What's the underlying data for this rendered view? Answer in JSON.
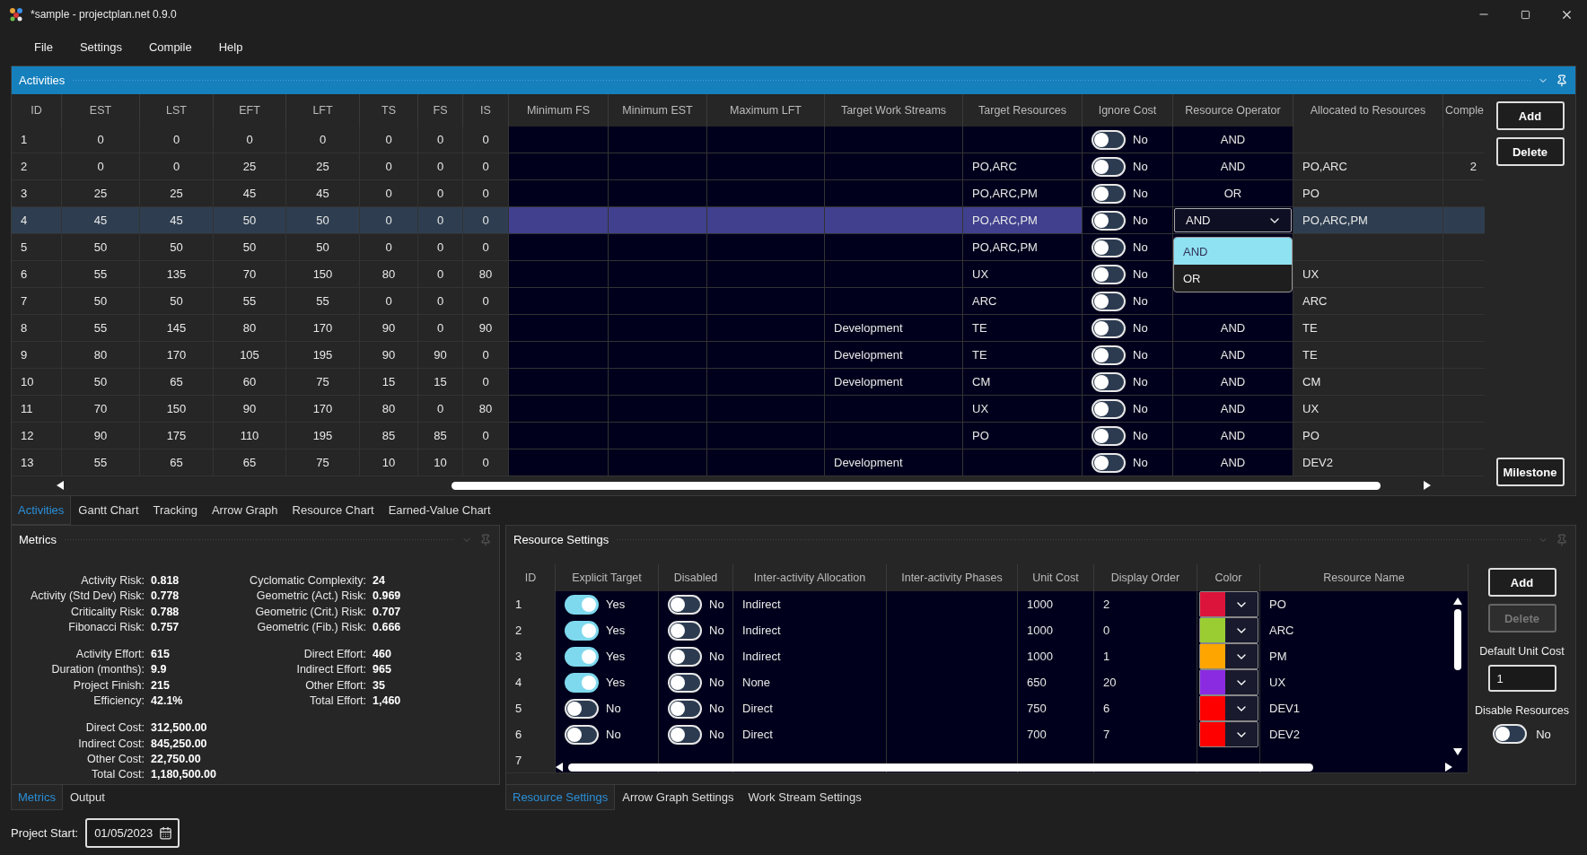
{
  "window": {
    "title": "*sample - projectplan.net 0.9.0"
  },
  "menu": [
    "File",
    "Settings",
    "Compile",
    "Help"
  ],
  "activities": {
    "title": "Activities",
    "columns": [
      "ID",
      "EST",
      "LST",
      "EFT",
      "LFT",
      "TS",
      "FS",
      "IS",
      "Minimum FS",
      "Minimum EST",
      "Maximum LFT",
      "Target Work Streams",
      "Target Resources",
      "Ignore Cost",
      "Resource Operator",
      "Allocated to Resources",
      "Comple"
    ],
    "rows": [
      {
        "cells": [
          "1",
          "0",
          "0",
          "0",
          "0",
          "0",
          "0",
          "0"
        ],
        "ignore_cost": {
          "on": false,
          "label": "No"
        },
        "resource_operator": "AND",
        "selected": false,
        "editing": false
      },
      {
        "cells": [
          "2",
          "0",
          "0",
          "25",
          "25",
          "0",
          "0",
          "0"
        ],
        "target_resources": "PO,ARC",
        "ignore_cost": {
          "on": false,
          "label": "No"
        },
        "resource_operator": "AND",
        "allocated": "PO,ARC",
        "complete": "2",
        "selected": false,
        "editing": false
      },
      {
        "cells": [
          "3",
          "25",
          "25",
          "45",
          "45",
          "0",
          "0",
          "0"
        ],
        "target_resources": "PO,ARC,PM",
        "ignore_cost": {
          "on": false,
          "label": "No"
        },
        "resource_operator": "OR",
        "allocated": "PO",
        "selected": false,
        "editing": false
      },
      {
        "cells": [
          "4",
          "45",
          "45",
          "50",
          "50",
          "0",
          "0",
          "0"
        ],
        "target_resources": "PO,ARC,PM",
        "ignore_cost": {
          "on": false,
          "label": "No"
        },
        "resource_operator": "AND",
        "allocated": "PO,ARC,PM",
        "selected": true,
        "editing": true
      },
      {
        "cells": [
          "5",
          "50",
          "50",
          "50",
          "50",
          "0",
          "0",
          "0"
        ],
        "target_resources": "PO,ARC,PM",
        "ignore_cost": {
          "on": false,
          "label": "No"
        },
        "selected": false,
        "editing": false
      },
      {
        "cells": [
          "6",
          "55",
          "135",
          "70",
          "150",
          "80",
          "0",
          "80"
        ],
        "target_resources": "UX",
        "ignore_cost": {
          "on": false,
          "label": "No"
        },
        "allocated": "UX",
        "selected": false,
        "editing": false
      },
      {
        "cells": [
          "7",
          "50",
          "50",
          "55",
          "55",
          "0",
          "0",
          "0"
        ],
        "target_resources": "ARC",
        "ignore_cost": {
          "on": false,
          "label": "No"
        },
        "allocated": "ARC",
        "selected": false,
        "editing": false
      },
      {
        "cells": [
          "8",
          "55",
          "145",
          "80",
          "170",
          "90",
          "0",
          "90"
        ],
        "target_work_streams": "Development",
        "target_resources": "TE",
        "ignore_cost": {
          "on": false,
          "label": "No"
        },
        "resource_operator": "AND",
        "allocated": "TE",
        "selected": false,
        "editing": false
      },
      {
        "cells": [
          "9",
          "80",
          "170",
          "105",
          "195",
          "90",
          "90",
          "0"
        ],
        "target_work_streams": "Development",
        "target_resources": "TE",
        "ignore_cost": {
          "on": false,
          "label": "No"
        },
        "resource_operator": "AND",
        "allocated": "TE",
        "selected": false,
        "editing": false
      },
      {
        "cells": [
          "10",
          "50",
          "65",
          "60",
          "75",
          "15",
          "15",
          "0"
        ],
        "target_work_streams": "Development",
        "target_resources": "CM",
        "ignore_cost": {
          "on": false,
          "label": "No"
        },
        "resource_operator": "AND",
        "allocated": "CM",
        "selected": false,
        "editing": false
      },
      {
        "cells": [
          "11",
          "70",
          "150",
          "90",
          "170",
          "80",
          "0",
          "80"
        ],
        "target_resources": "UX",
        "ignore_cost": {
          "on": false,
          "label": "No"
        },
        "resource_operator": "AND",
        "allocated": "UX",
        "selected": false,
        "editing": false
      },
      {
        "cells": [
          "12",
          "90",
          "175",
          "110",
          "195",
          "85",
          "85",
          "0"
        ],
        "target_resources": "PO",
        "ignore_cost": {
          "on": false,
          "label": "No"
        },
        "resource_operator": "AND",
        "allocated": "PO",
        "selected": false,
        "editing": false
      },
      {
        "cells": [
          "13",
          "55",
          "65",
          "65",
          "75",
          "10",
          "10",
          "0"
        ],
        "target_work_streams": "Development",
        "ignore_cost": {
          "on": false,
          "label": "No"
        },
        "resource_operator": "AND",
        "allocated": "DEV2",
        "selected": false,
        "editing": false
      }
    ],
    "operator_menu": [
      {
        "label": "AND",
        "selected": true
      },
      {
        "label": "OR",
        "selected": false
      }
    ],
    "buttons": [
      "Add",
      "Delete",
      "Milestone"
    ]
  },
  "view_tabs": [
    {
      "label": "Activities",
      "selected": true
    },
    {
      "label": "Gantt Chart",
      "selected": false
    },
    {
      "label": "Tracking",
      "selected": false
    },
    {
      "label": "Arrow Graph",
      "selected": false
    },
    {
      "label": "Resource Chart",
      "selected": false
    },
    {
      "label": "Earned-Value Chart",
      "selected": false
    }
  ],
  "metrics": {
    "title": "Metrics",
    "left": [
      [
        {
          "label": "Activity Risk:",
          "value": "0.818"
        },
        {
          "label": "Activity (Std Dev) Risk:",
          "value": "0.778"
        },
        {
          "label": "Criticality Risk:",
          "value": "0.788"
        },
        {
          "label": "Fibonacci Risk:",
          "value": "0.757"
        }
      ],
      [
        {
          "label": "Activity Effort:",
          "value": "615"
        },
        {
          "label": "Duration (months):",
          "value": "9.9"
        },
        {
          "label": "Project Finish:",
          "value": "215"
        },
        {
          "label": "Efficiency:",
          "value": "42.1%"
        }
      ],
      [
        {
          "label": "Direct Cost:",
          "value": "312,500.00"
        },
        {
          "label": "Indirect Cost:",
          "value": "845,250.00"
        },
        {
          "label": "Other Cost:",
          "value": "22,750.00"
        },
        {
          "label": "Total Cost:",
          "value": "1,180,500.00"
        }
      ]
    ],
    "right": [
      [
        {
          "label": "Cyclomatic Complexity:",
          "value": "24"
        },
        {
          "label": "Geometric (Act.) Risk:",
          "value": "0.969"
        },
        {
          "label": "Geometric (Crit.) Risk:",
          "value": "0.707"
        },
        {
          "label": "Geometric (Fib.) Risk:",
          "value": "0.666"
        }
      ],
      [
        {
          "label": "Direct Effort:",
          "value": "460"
        },
        {
          "label": "Indirect Effort:",
          "value": "965"
        },
        {
          "label": "Other Effort:",
          "value": "35"
        },
        {
          "label": "Total Effort:",
          "value": "1,460"
        }
      ]
    ],
    "tabs": [
      {
        "label": "Metrics",
        "selected": true
      },
      {
        "label": "Output",
        "selected": false
      }
    ]
  },
  "resources": {
    "title": "Resource Settings",
    "columns": [
      "ID",
      "Explicit Target",
      "Disabled",
      "Inter-activity Allocation",
      "Inter-activity Phases",
      "Unit Cost",
      "Display Order",
      "Color",
      "Resource Name"
    ],
    "rows": [
      {
        "id": "1",
        "explicit_target": {
          "on": true,
          "label": "Yes"
        },
        "disabled": {
          "on": false,
          "label": "No"
        },
        "allocation": "Indirect",
        "unit_cost": "1000",
        "display_order": "2",
        "color": "#dc143c",
        "name": "PO"
      },
      {
        "id": "2",
        "explicit_target": {
          "on": true,
          "label": "Yes"
        },
        "disabled": {
          "on": false,
          "label": "No"
        },
        "allocation": "Indirect",
        "unit_cost": "1000",
        "display_order": "0",
        "color": "#9acd32",
        "name": "ARC"
      },
      {
        "id": "3",
        "explicit_target": {
          "on": true,
          "label": "Yes"
        },
        "disabled": {
          "on": false,
          "label": "No"
        },
        "allocation": "Indirect",
        "unit_cost": "1000",
        "display_order": "1",
        "color": "#ffa500",
        "name": "PM"
      },
      {
        "id": "4",
        "explicit_target": {
          "on": true,
          "label": "Yes"
        },
        "disabled": {
          "on": false,
          "label": "No"
        },
        "allocation": "None",
        "unit_cost": "650",
        "display_order": "20",
        "color": "#8a2be2",
        "name": "UX"
      },
      {
        "id": "5",
        "explicit_target": {
          "on": false,
          "label": "No"
        },
        "disabled": {
          "on": false,
          "label": "No"
        },
        "allocation": "Direct",
        "unit_cost": "750",
        "display_order": "6",
        "color": "#ff0000",
        "name": "DEV1"
      },
      {
        "id": "6",
        "explicit_target": {
          "on": false,
          "label": "No"
        },
        "disabled": {
          "on": false,
          "label": "No"
        },
        "allocation": "Direct",
        "unit_cost": "700",
        "display_order": "7",
        "color": "#ff0000",
        "name": "DEV2"
      },
      {
        "id": "7"
      }
    ],
    "buttons": [
      {
        "label": "Add",
        "disabled": false
      },
      {
        "label": "Delete",
        "disabled": true
      }
    ],
    "default_unit_cost": {
      "label": "Default Unit Cost",
      "value": "1"
    },
    "disable_resources": {
      "label": "Disable Resources",
      "on": false,
      "text": "No"
    },
    "tabs": [
      {
        "label": "Resource Settings",
        "selected": true
      },
      {
        "label": "Arrow Graph Settings",
        "selected": false
      },
      {
        "label": "Work Stream Settings",
        "selected": false
      }
    ]
  },
  "project_start": {
    "label": "Project Start:",
    "value": "01/05/2023"
  }
}
